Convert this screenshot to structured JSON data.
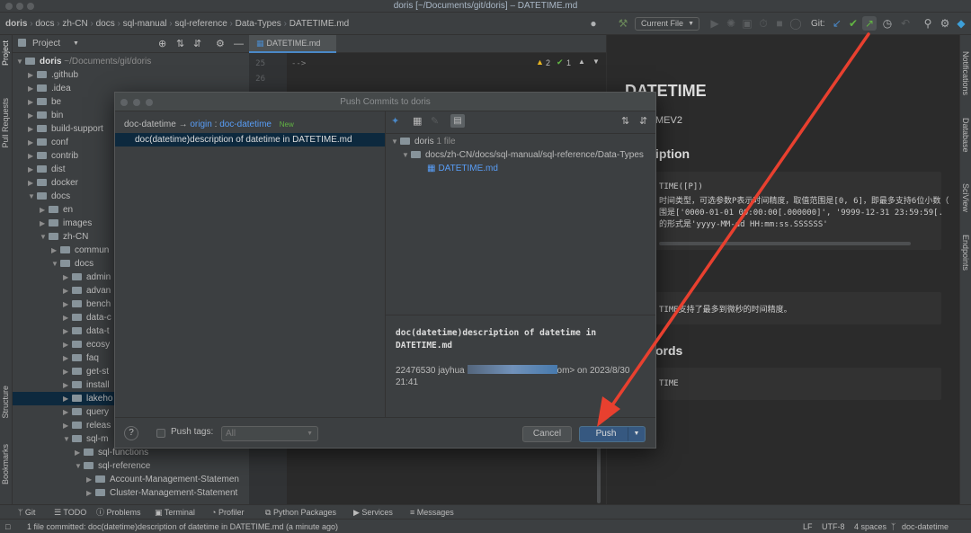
{
  "window": {
    "title": "doris [~/Documents/git/doris] – DATETIME.md"
  },
  "navbar": {
    "breadcrumbs": [
      "doris",
      "docs",
      "zh-CN",
      "docs",
      "sql-manual",
      "sql-reference",
      "Data-Types",
      "DATETIME.md"
    ],
    "run_config": "Current File",
    "git_label": "Git:"
  },
  "stripes": {
    "left_top": [
      "Project",
      "Pull Requests"
    ],
    "left_bottom": [
      "Structure",
      "Bookmarks"
    ],
    "right": [
      "Notifications",
      "Database",
      "SciView",
      "Endpoints"
    ]
  },
  "project": {
    "header_label": "Project",
    "root_name": "doris",
    "root_path": "~/Documents/git/doris",
    "tree": [
      {
        "label": ".github",
        "depth": 1,
        "expanded": false
      },
      {
        "label": ".idea",
        "depth": 1,
        "expanded": false
      },
      {
        "label": "be",
        "depth": 1,
        "expanded": false
      },
      {
        "label": "bin",
        "depth": 1,
        "expanded": false
      },
      {
        "label": "build-support",
        "depth": 1,
        "expanded": false
      },
      {
        "label": "conf",
        "depth": 1,
        "expanded": false
      },
      {
        "label": "contrib",
        "depth": 1,
        "expanded": false
      },
      {
        "label": "dist",
        "depth": 1,
        "expanded": false
      },
      {
        "label": "docker",
        "depth": 1,
        "expanded": false
      },
      {
        "label": "docs",
        "depth": 1,
        "expanded": true
      },
      {
        "label": "en",
        "depth": 2,
        "expanded": false
      },
      {
        "label": "images",
        "depth": 2,
        "expanded": false
      },
      {
        "label": "zh-CN",
        "depth": 2,
        "expanded": true
      },
      {
        "label": "commun",
        "depth": 3,
        "expanded": false
      },
      {
        "label": "docs",
        "depth": 3,
        "expanded": true
      },
      {
        "label": "admin",
        "depth": 4,
        "expanded": false
      },
      {
        "label": "advan",
        "depth": 4,
        "expanded": false
      },
      {
        "label": "bench",
        "depth": 4,
        "expanded": false
      },
      {
        "label": "data-c",
        "depth": 4,
        "expanded": false
      },
      {
        "label": "data-t",
        "depth": 4,
        "expanded": false
      },
      {
        "label": "ecosy",
        "depth": 4,
        "expanded": false
      },
      {
        "label": "faq",
        "depth": 4,
        "expanded": false
      },
      {
        "label": "get-st",
        "depth": 4,
        "expanded": false
      },
      {
        "label": "install",
        "depth": 4,
        "expanded": false
      },
      {
        "label": "lakeho",
        "depth": 4,
        "expanded": false,
        "selected": true
      },
      {
        "label": "query",
        "depth": 4,
        "expanded": false
      },
      {
        "label": "releas",
        "depth": 4,
        "expanded": false
      },
      {
        "label": "sql-m",
        "depth": 4,
        "expanded": true
      },
      {
        "label": "sql-functions",
        "depth": 5,
        "expanded": false
      },
      {
        "label": "sql-reference",
        "depth": 5,
        "expanded": true
      },
      {
        "label": "Account-Management-Statemen",
        "depth": 6,
        "expanded": false
      },
      {
        "label": "Cluster-Management-Statement",
        "depth": 6,
        "expanded": false
      }
    ]
  },
  "editor": {
    "tab_label": "DATETIME.md",
    "line_numbers": [
      "25",
      "26"
    ],
    "code_line": "-->",
    "warnings": "2",
    "oks": "1"
  },
  "preview": {
    "title": "DATETIME",
    "name_fragment": "MEV2",
    "heading_description": "iption",
    "code1": [
      "TIME([P])",
      "时间类型，可选参数P表示时间精度，取值范围是[0, 6]，即最多支持6位小数（",
      "围是['0000-01-01 00:00:00[.000000]', '9999-12-31 23:59:59[.",
      "的形式是'yyyy-MM-dd HH:mm:ss.SSSSSS'"
    ],
    "code2": "TIME支持了最多到微秒的时间精度。",
    "heading_keywords": "ords",
    "code3": "TIME"
  },
  "dialog": {
    "title": "Push Commits to doris",
    "branch_local": "doc-datetime",
    "branch_arrow": "→",
    "branch_remote": "origin",
    "branch_sep": ":",
    "branch_remote_name": "doc-datetime",
    "branch_badge": "New",
    "commit_message": "doc(datetime)description of datetime in DATETIME.md",
    "tree_root": "doris",
    "tree_root_count": "1 file",
    "tree_path": "docs/zh-CN/docs/sql-manual/sql-reference/Data-Types",
    "tree_file": "DATETIME.md",
    "details_message": "doc(datetime)description of datetime in DATETIME.md",
    "details_author": "22476530 jayhua",
    "details_email_end": "om>",
    "details_on": "on 2023/8/30",
    "details_time": "21:41",
    "help_label": "?",
    "push_tags_label": "Push tags:",
    "push_tags_value": "All",
    "cancel_label": "Cancel",
    "push_label": "Push"
  },
  "bottom_tools": [
    "Git",
    "TODO",
    "Problems",
    "Terminal",
    "Profiler",
    "Python Packages",
    "Services",
    "Messages"
  ],
  "status": {
    "message": "1 file committed: doc(datetime)description of datetime in DATETIME.md (a minute ago)",
    "line_sep": "LF",
    "encoding": "UTF-8",
    "indent": "4 spaces",
    "branch": "doc-datetime"
  },
  "colors": {
    "accent": "#4a88c7",
    "push_button": "#365880",
    "annotation_arrow": "#e8402f",
    "selection": "#0d293e"
  }
}
